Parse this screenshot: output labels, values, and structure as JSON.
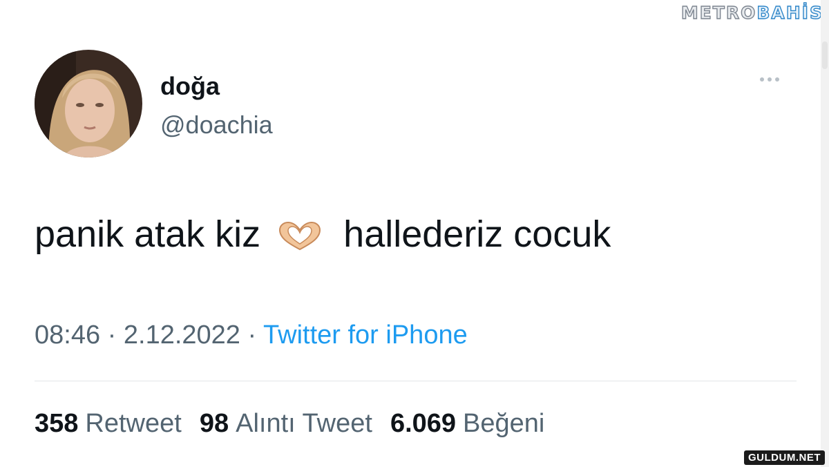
{
  "watermark": {
    "part1": "METRO",
    "part2": "BAHİS"
  },
  "author": {
    "display_name": "doğa",
    "handle": "@doachia"
  },
  "tweet": {
    "text_before": "panik atak kiz",
    "emoji_icon": "heart-hands-icon",
    "text_after": "hallederiz cocuk"
  },
  "meta": {
    "time": "08:46",
    "date": "2.12.2022",
    "separator": "·",
    "source": "Twitter for iPhone"
  },
  "stats": {
    "retweets": {
      "count": "358",
      "label": "Retweet"
    },
    "quotes": {
      "count": "98",
      "label": "Alıntı Tweet"
    },
    "likes": {
      "count": "6.069",
      "label": "Beğeni"
    }
  },
  "footer_watermark": "GULDUM.NET",
  "colors": {
    "text_primary": "#0f1419",
    "text_secondary": "#536471",
    "link": "#1d9bf0",
    "divider": "#e3e6e8"
  }
}
